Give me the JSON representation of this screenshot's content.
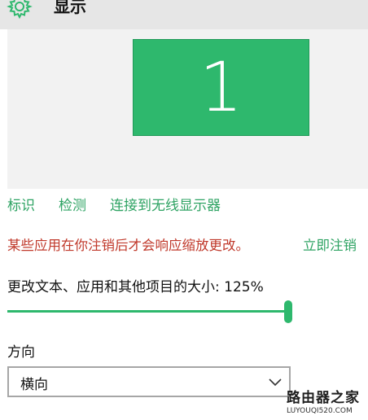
{
  "header": {
    "title": "显示",
    "icon": "gear-icon"
  },
  "preview": {
    "monitor_number": "1",
    "monitor_color": "#2eb86d"
  },
  "links": {
    "identify": "标识",
    "detect": "检测",
    "connect_wireless": "连接到无线显示器"
  },
  "notice": {
    "message": "某些应用在你注销后才会响应缩放更改。",
    "action": "立即注销",
    "message_color": "#c0392b",
    "accent_color": "#2ea363"
  },
  "scale": {
    "label": "更改文本、应用和其他项目的大小: 125%",
    "value_fraction": 1.0
  },
  "orientation": {
    "label": "方向",
    "selected": "横向",
    "chevron_icon": "chevron-down-icon"
  },
  "watermark": {
    "text": "路由器之家",
    "url": "LUYOUQI520.COM"
  }
}
